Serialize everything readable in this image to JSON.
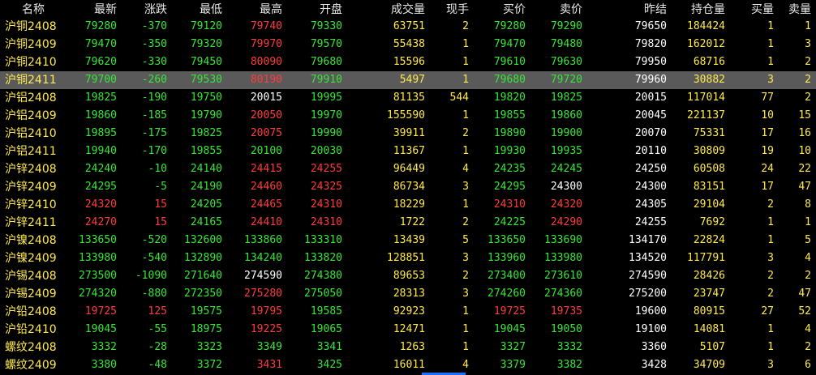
{
  "columns": {
    "name": "名称",
    "last": "最新",
    "change": "涨跌",
    "low": "最低",
    "high": "最高",
    "open": "开盘",
    "volume": "成交量",
    "cur_vol": "现手",
    "bid": "买价",
    "ask": "卖价",
    "prev_settle": "昨结",
    "open_interest": "持仓量",
    "bid_vol": "买量",
    "ask_vol": "卖量"
  },
  "colors": {
    "up": "#ff3b3b",
    "down": "#37e637",
    "flat": "#ffffff",
    "volume": "#ffe94d",
    "selected_row": "#5a5a5a"
  },
  "selected_row": 3,
  "rows": [
    {
      "name": "沪铜2408",
      "last": "79280",
      "change": "-370",
      "low": "79120",
      "high": "79740",
      "open": "79330",
      "volume": "63751",
      "cur_vol": "2",
      "bid": "79280",
      "ask": "79290",
      "prev_settle": "79650",
      "open_interest": "184424",
      "bid_vol": "1",
      "ask_vol": "1"
    },
    {
      "name": "沪铜2409",
      "last": "79470",
      "change": "-350",
      "low": "79320",
      "high": "79970",
      "open": "79570",
      "volume": "55438",
      "cur_vol": "1",
      "bid": "79470",
      "ask": "79480",
      "prev_settle": "79820",
      "open_interest": "162012",
      "bid_vol": "1",
      "ask_vol": "3"
    },
    {
      "name": "沪铜2410",
      "last": "79620",
      "change": "-330",
      "low": "79450",
      "high": "80090",
      "open": "79680",
      "volume": "15596",
      "cur_vol": "1",
      "bid": "79610",
      "ask": "79630",
      "prev_settle": "79950",
      "open_interest": "68716",
      "bid_vol": "1",
      "ask_vol": "2"
    },
    {
      "name": "沪铜2411",
      "last": "79700",
      "change": "-260",
      "low": "79530",
      "high": "80190",
      "open": "79910",
      "volume": "5497",
      "cur_vol": "1",
      "bid": "79680",
      "ask": "79720",
      "prev_settle": "79960",
      "open_interest": "30882",
      "bid_vol": "3",
      "ask_vol": "2"
    },
    {
      "name": "沪铝2408",
      "last": "19825",
      "change": "-190",
      "low": "19750",
      "high": "20015",
      "open": "19995",
      "volume": "81135",
      "cur_vol": "544",
      "bid": "19820",
      "ask": "19825",
      "prev_settle": "20015",
      "open_interest": "117014",
      "bid_vol": "77",
      "ask_vol": "2"
    },
    {
      "name": "沪铝2409",
      "last": "19860",
      "change": "-185",
      "low": "19790",
      "high": "20050",
      "open": "19970",
      "volume": "155590",
      "cur_vol": "1",
      "bid": "19855",
      "ask": "19860",
      "prev_settle": "20045",
      "open_interest": "221137",
      "bid_vol": "10",
      "ask_vol": "15"
    },
    {
      "name": "沪铝2410",
      "last": "19895",
      "change": "-175",
      "low": "19825",
      "high": "20075",
      "open": "19990",
      "volume": "39911",
      "cur_vol": "2",
      "bid": "19890",
      "ask": "19900",
      "prev_settle": "20070",
      "open_interest": "75331",
      "bid_vol": "17",
      "ask_vol": "16"
    },
    {
      "name": "沪铝2411",
      "last": "19940",
      "change": "-170",
      "low": "19855",
      "high": "20100",
      "open": "20030",
      "volume": "11367",
      "cur_vol": "1",
      "bid": "19930",
      "ask": "19935",
      "prev_settle": "20110",
      "open_interest": "30809",
      "bid_vol": "19",
      "ask_vol": "10"
    },
    {
      "name": "沪锌2408",
      "last": "24240",
      "change": "-10",
      "low": "24140",
      "high": "24415",
      "open": "24255",
      "volume": "96449",
      "cur_vol": "4",
      "bid": "24235",
      "ask": "24245",
      "prev_settle": "24250",
      "open_interest": "60508",
      "bid_vol": "24",
      "ask_vol": "22"
    },
    {
      "name": "沪锌2409",
      "last": "24295",
      "change": "-5",
      "low": "24190",
      "high": "24460",
      "open": "24325",
      "volume": "86734",
      "cur_vol": "3",
      "bid": "24295",
      "ask": "24300",
      "prev_settle": "24300",
      "open_interest": "83151",
      "bid_vol": "17",
      "ask_vol": "47"
    },
    {
      "name": "沪锌2410",
      "last": "24320",
      "change": "15",
      "low": "24205",
      "high": "24465",
      "open": "24310",
      "volume": "18229",
      "cur_vol": "1",
      "bid": "24310",
      "ask": "24320",
      "prev_settle": "24305",
      "open_interest": "29104",
      "bid_vol": "2",
      "ask_vol": "8"
    },
    {
      "name": "沪锌2411",
      "last": "24270",
      "change": "15",
      "low": "24165",
      "high": "24410",
      "open": "24310",
      "volume": "1722",
      "cur_vol": "2",
      "bid": "24225",
      "ask": "24290",
      "prev_settle": "24255",
      "open_interest": "7692",
      "bid_vol": "1",
      "ask_vol": "1"
    },
    {
      "name": "沪镍2408",
      "last": "133650",
      "change": "-520",
      "low": "132600",
      "high": "133860",
      "open": "133310",
      "volume": "13439",
      "cur_vol": "5",
      "bid": "133650",
      "ask": "133690",
      "prev_settle": "134170",
      "open_interest": "22824",
      "bid_vol": "1",
      "ask_vol": "5"
    },
    {
      "name": "沪镍2409",
      "last": "133980",
      "change": "-540",
      "low": "132890",
      "high": "134240",
      "open": "133820",
      "volume": "128851",
      "cur_vol": "3",
      "bid": "133960",
      "ask": "133980",
      "prev_settle": "134520",
      "open_interest": "117791",
      "bid_vol": "3",
      "ask_vol": "4"
    },
    {
      "name": "沪锡2408",
      "last": "273500",
      "change": "-1090",
      "low": "271640",
      "high": "274590",
      "open": "274380",
      "volume": "89653",
      "cur_vol": "2",
      "bid": "273400",
      "ask": "273610",
      "prev_settle": "274590",
      "open_interest": "28426",
      "bid_vol": "2",
      "ask_vol": "2"
    },
    {
      "name": "沪锡2409",
      "last": "274320",
      "change": "-880",
      "low": "272350",
      "high": "275280",
      "open": "275050",
      "volume": "28313",
      "cur_vol": "3",
      "bid": "274260",
      "ask": "274360",
      "prev_settle": "275200",
      "open_interest": "23747",
      "bid_vol": "2",
      "ask_vol": "47"
    },
    {
      "name": "沪铅2408",
      "last": "19725",
      "change": "125",
      "low": "19575",
      "high": "19795",
      "open": "19585",
      "volume": "92923",
      "cur_vol": "1",
      "bid": "19725",
      "ask": "19735",
      "prev_settle": "19600",
      "open_interest": "80915",
      "bid_vol": "27",
      "ask_vol": "52"
    },
    {
      "name": "沪铅2410",
      "last": "19045",
      "change": "-55",
      "low": "18975",
      "high": "19225",
      "open": "19065",
      "volume": "12471",
      "cur_vol": "1",
      "bid": "19045",
      "ask": "19050",
      "prev_settle": "19100",
      "open_interest": "14081",
      "bid_vol": "1",
      "ask_vol": "4"
    },
    {
      "name": "螺纹2408",
      "last": "3332",
      "change": "-28",
      "low": "3323",
      "high": "3349",
      "open": "3341",
      "volume": "1263",
      "cur_vol": "1",
      "bid": "3327",
      "ask": "3332",
      "prev_settle": "3360",
      "open_interest": "5107",
      "bid_vol": "1",
      "ask_vol": "2"
    },
    {
      "name": "螺纹2409",
      "last": "3380",
      "change": "-48",
      "low": "3372",
      "high": "3431",
      "open": "3425",
      "volume": "16011",
      "cur_vol": "4",
      "bid": "3379",
      "ask": "3382",
      "prev_settle": "3428",
      "open_interest": "34709",
      "bid_vol": "3",
      "ask_vol": "6"
    }
  ]
}
